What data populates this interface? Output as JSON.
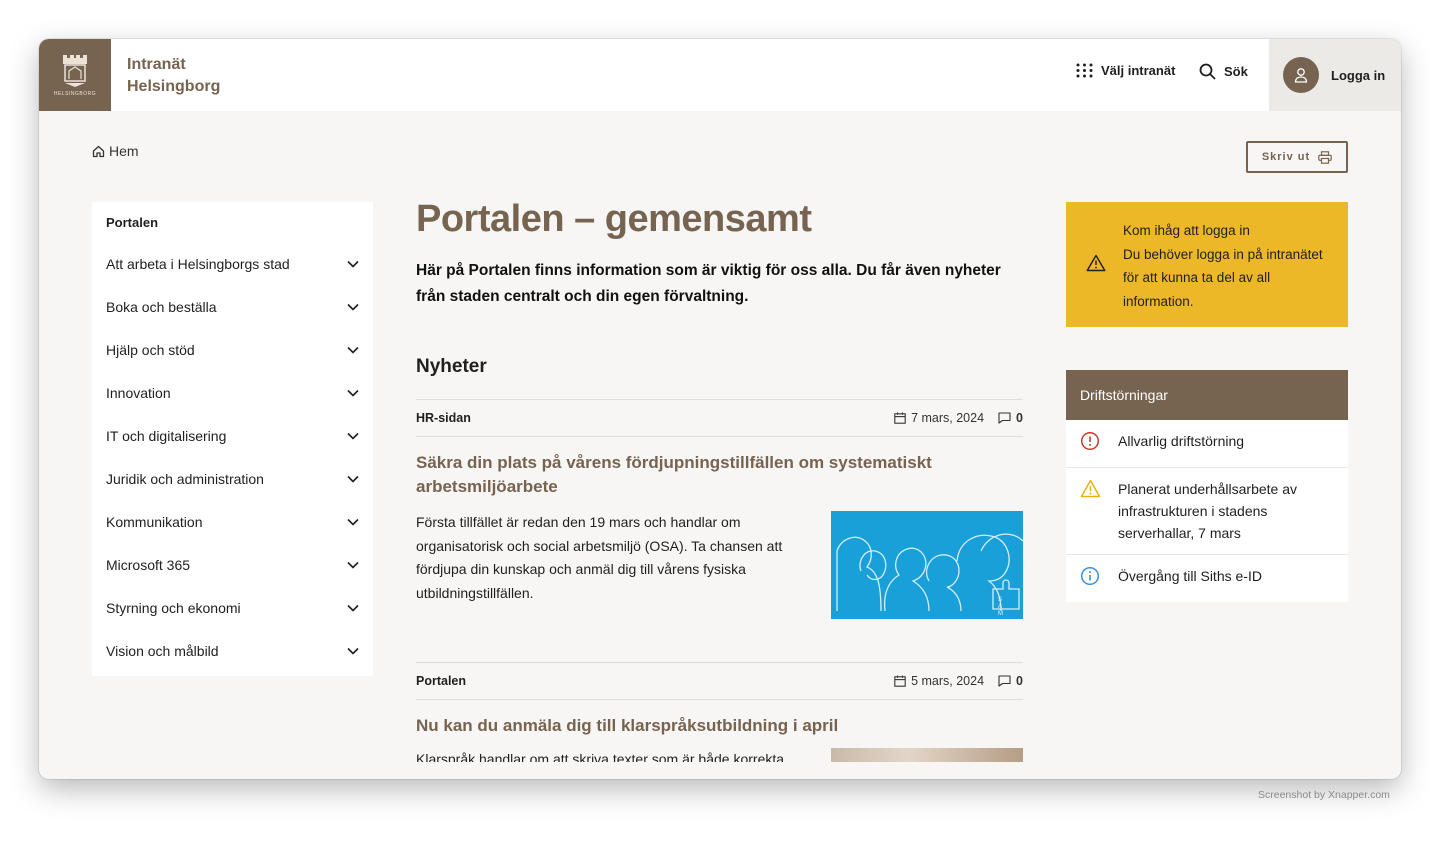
{
  "header": {
    "logo_text": "HELSINGBORG",
    "brand_line1": "Intranät",
    "brand_line2": "Helsingborg",
    "choose_intranet": "Välj intranät",
    "search": "Sök",
    "login": "Logga in"
  },
  "breadcrumb": {
    "home": "Hem"
  },
  "print_label": "Skriv ut",
  "sidebar": {
    "heading": "Portalen",
    "items": [
      {
        "label": "Att arbeta i Helsingborgs stad"
      },
      {
        "label": "Boka och beställa"
      },
      {
        "label": "Hjälp och stöd"
      },
      {
        "label": "Innovation"
      },
      {
        "label": "IT och digitalisering"
      },
      {
        "label": "Juridik och administration"
      },
      {
        "label": "Kommunikation"
      },
      {
        "label": "Microsoft 365"
      },
      {
        "label": "Styrning och ekonomi"
      },
      {
        "label": "Vision och målbild"
      }
    ]
  },
  "main": {
    "title": "Portalen – gemensamt",
    "lead": "Här på Portalen finns information som är viktig för oss alla. Du får även nyheter från staden centralt och din egen förvaltning.",
    "news_heading": "Nyheter",
    "articles": [
      {
        "category": "HR-sidan",
        "date": "7 mars, 2024",
        "comments": "0",
        "title": "Säkra din plats på vårens fördjupningstillfällen om systematiskt arbetsmiljöarbete",
        "body": "Första tillfället är redan den 19 mars och handlar om organisatorisk och social arbetsmiljö (OSA). Ta chansen att fördjupa din kunskap och anmäl dig till vårens fysiska utbildningstillfällen."
      },
      {
        "category": "Portalen",
        "date": "5 mars, 2024",
        "comments": "0",
        "title": "Nu kan du anmäla dig till klarspråksutbildning i april",
        "body": "Klarspråk handlar om att skriva texter som är både korrekta"
      }
    ]
  },
  "notice": {
    "line1": "Kom ihåg att logga in",
    "line2": "Du behöver logga in på intranätet för att kunna ta del av all information."
  },
  "disruptions": {
    "heading": "Driftstörningar",
    "items": [
      {
        "text": "Allvarlig driftstörning",
        "icon": "error-circle-icon",
        "color": "#c8382c"
      },
      {
        "text": "Planerat underhållsarbete av infrastrukturen i stadens serverhallar, 7 mars",
        "icon": "warning-triangle-icon",
        "color": "#e3b410"
      },
      {
        "text": "Övergång till Siths e-ID",
        "icon": "info-circle-icon",
        "color": "#3f8fd6"
      }
    ]
  },
  "colors": {
    "brand": "#766350",
    "notice": "#ecb828",
    "image_blue": "#1aa0d8"
  },
  "credit": "Screenshot by Xnapper.com"
}
